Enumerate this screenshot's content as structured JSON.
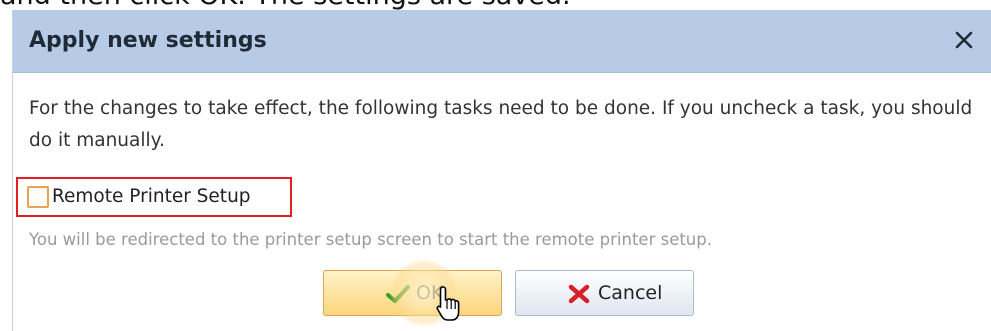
{
  "instruction_text": "and then click OK. The settings are saved.",
  "dialog": {
    "title": "Apply new settings",
    "close_icon": "close-icon",
    "message": "For the changes to take effect, the following tasks need to be done. If you uncheck a task, you should do it manually.",
    "task": {
      "label": "Remote Printer Setup",
      "checked": false,
      "hint": "You will be redirected to the printer setup screen to start the remote printer setup."
    },
    "buttons": {
      "ok_label": "OK",
      "ok_icon": "checkmark-icon",
      "cancel_label": "Cancel",
      "cancel_icon": "red-x-icon"
    }
  },
  "colors": {
    "titlebar": "#b8cbe6",
    "highlight_border": "#e01f25",
    "checkbox_border": "#e6a256",
    "ok_button": "#fcd57e",
    "checkmark": "#3a9a22",
    "cancel_icon": "#d6202a"
  }
}
